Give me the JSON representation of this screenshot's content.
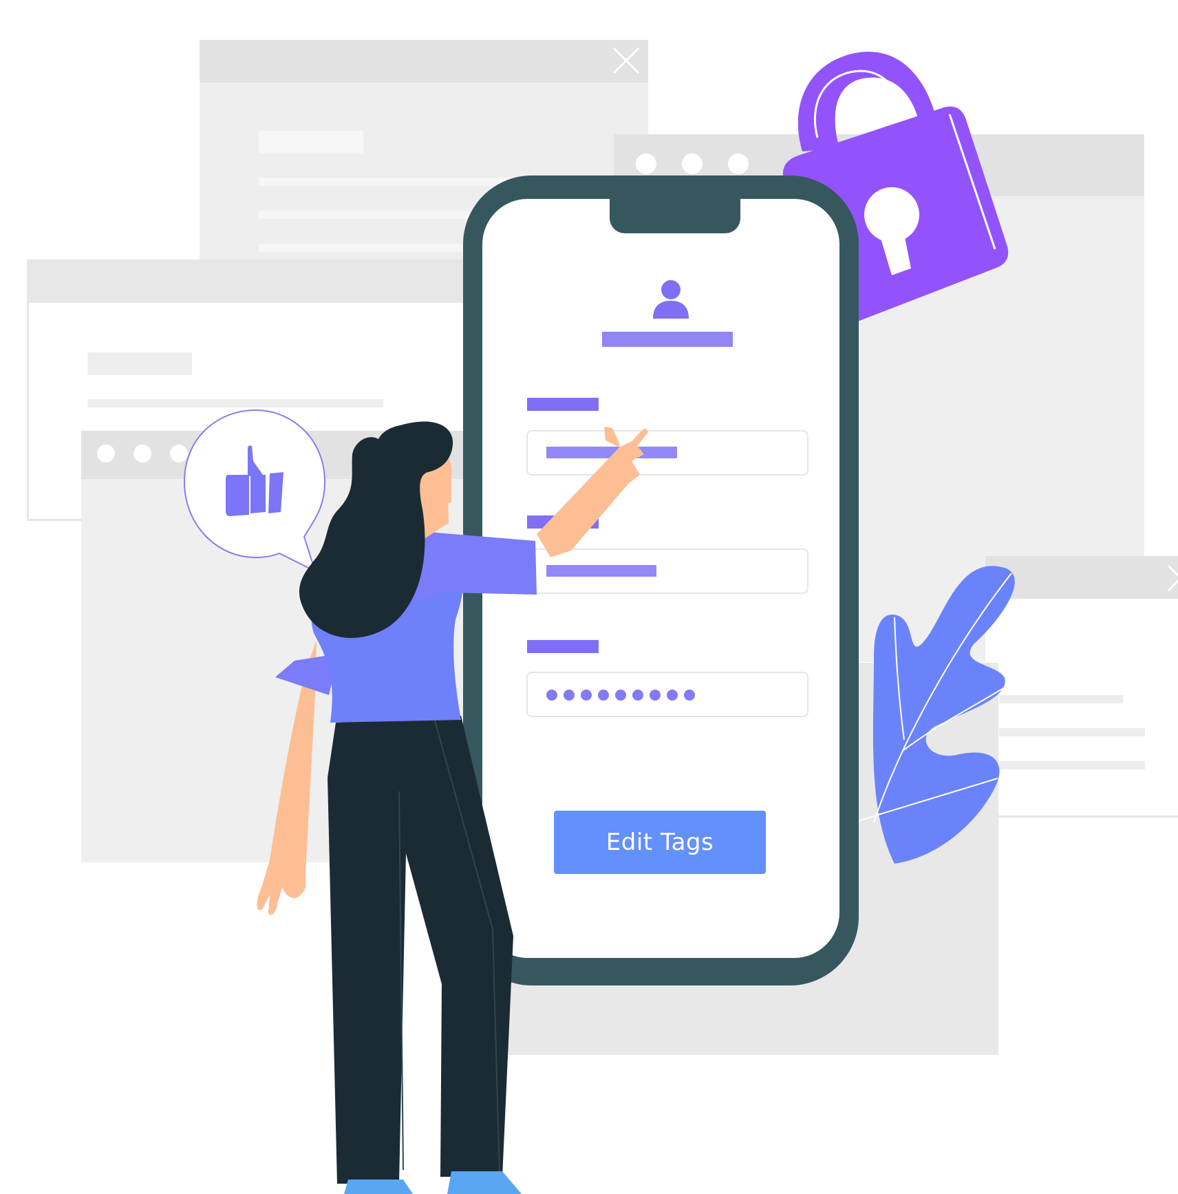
{
  "form": {
    "submit_label": "Edit Tags",
    "password_dot_count": 9
  },
  "icons": {
    "profile": "user-icon",
    "like": "thumbs-up-icon",
    "lock": "padlock-icon",
    "close": "close-icon"
  },
  "colors": {
    "accent": "#7f6ff4",
    "button": "#6490fb",
    "phone_frame": "#37575f",
    "lock": "#9253fc",
    "window_gray": "#e8e8e8"
  }
}
